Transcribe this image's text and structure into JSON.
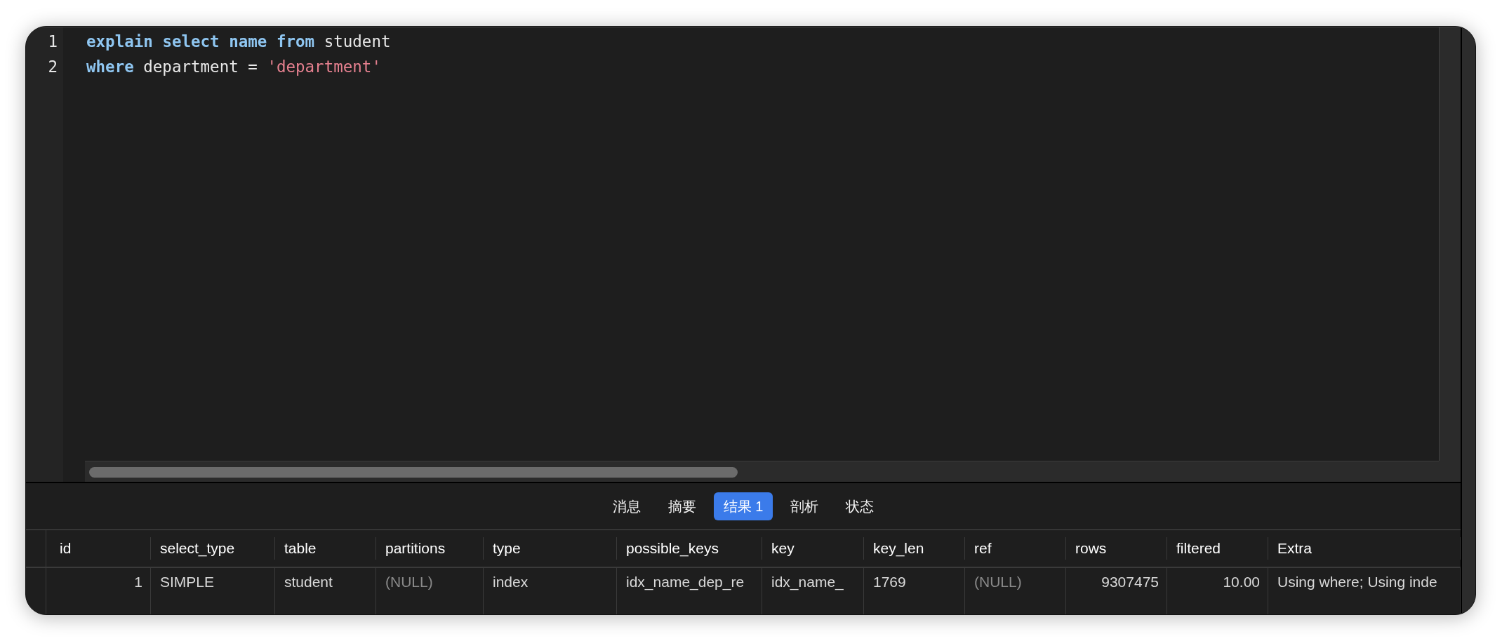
{
  "editor": {
    "lines": [
      {
        "number": "1",
        "tokens": [
          {
            "kind": "keyword",
            "text": "explain"
          },
          {
            "kind": "keyword",
            "text": "select"
          },
          {
            "kind": "keyword",
            "text": "name"
          },
          {
            "kind": "keyword",
            "text": "from"
          },
          {
            "kind": "plain",
            "text": "student"
          }
        ]
      },
      {
        "number": "2",
        "tokens": [
          {
            "kind": "keyword",
            "text": "where"
          },
          {
            "kind": "plain",
            "text": "department"
          },
          {
            "kind": "plain",
            "text": "="
          },
          {
            "kind": "string",
            "text": "'department'"
          }
        ]
      }
    ]
  },
  "result_tabs": [
    {
      "label": "消息",
      "selected": false
    },
    {
      "label": "摘要",
      "selected": false
    },
    {
      "label": "结果 1",
      "selected": true
    },
    {
      "label": "剖析",
      "selected": false
    },
    {
      "label": "状态",
      "selected": false
    }
  ],
  "result_table": {
    "columns": [
      "id",
      "select_type",
      "table",
      "partitions",
      "type",
      "possible_keys",
      "key",
      "key_len",
      "ref",
      "rows",
      "filtered",
      "Extra"
    ],
    "rows": [
      [
        {
          "kind": "number",
          "text": "1"
        },
        {
          "kind": "text",
          "text": "SIMPLE"
        },
        {
          "kind": "text",
          "text": "student"
        },
        {
          "kind": "null",
          "text": "(NULL)"
        },
        {
          "kind": "text",
          "text": "index"
        },
        {
          "kind": "text",
          "text": "idx_name_dep_re"
        },
        {
          "kind": "text",
          "text": "idx_name_"
        },
        {
          "kind": "text",
          "text": "1769"
        },
        {
          "kind": "null",
          "text": "(NULL)"
        },
        {
          "kind": "number",
          "text": "9307475"
        },
        {
          "kind": "number",
          "text": "10.00"
        },
        {
          "kind": "text",
          "text": "Using where; Using inde"
        }
      ]
    ]
  }
}
